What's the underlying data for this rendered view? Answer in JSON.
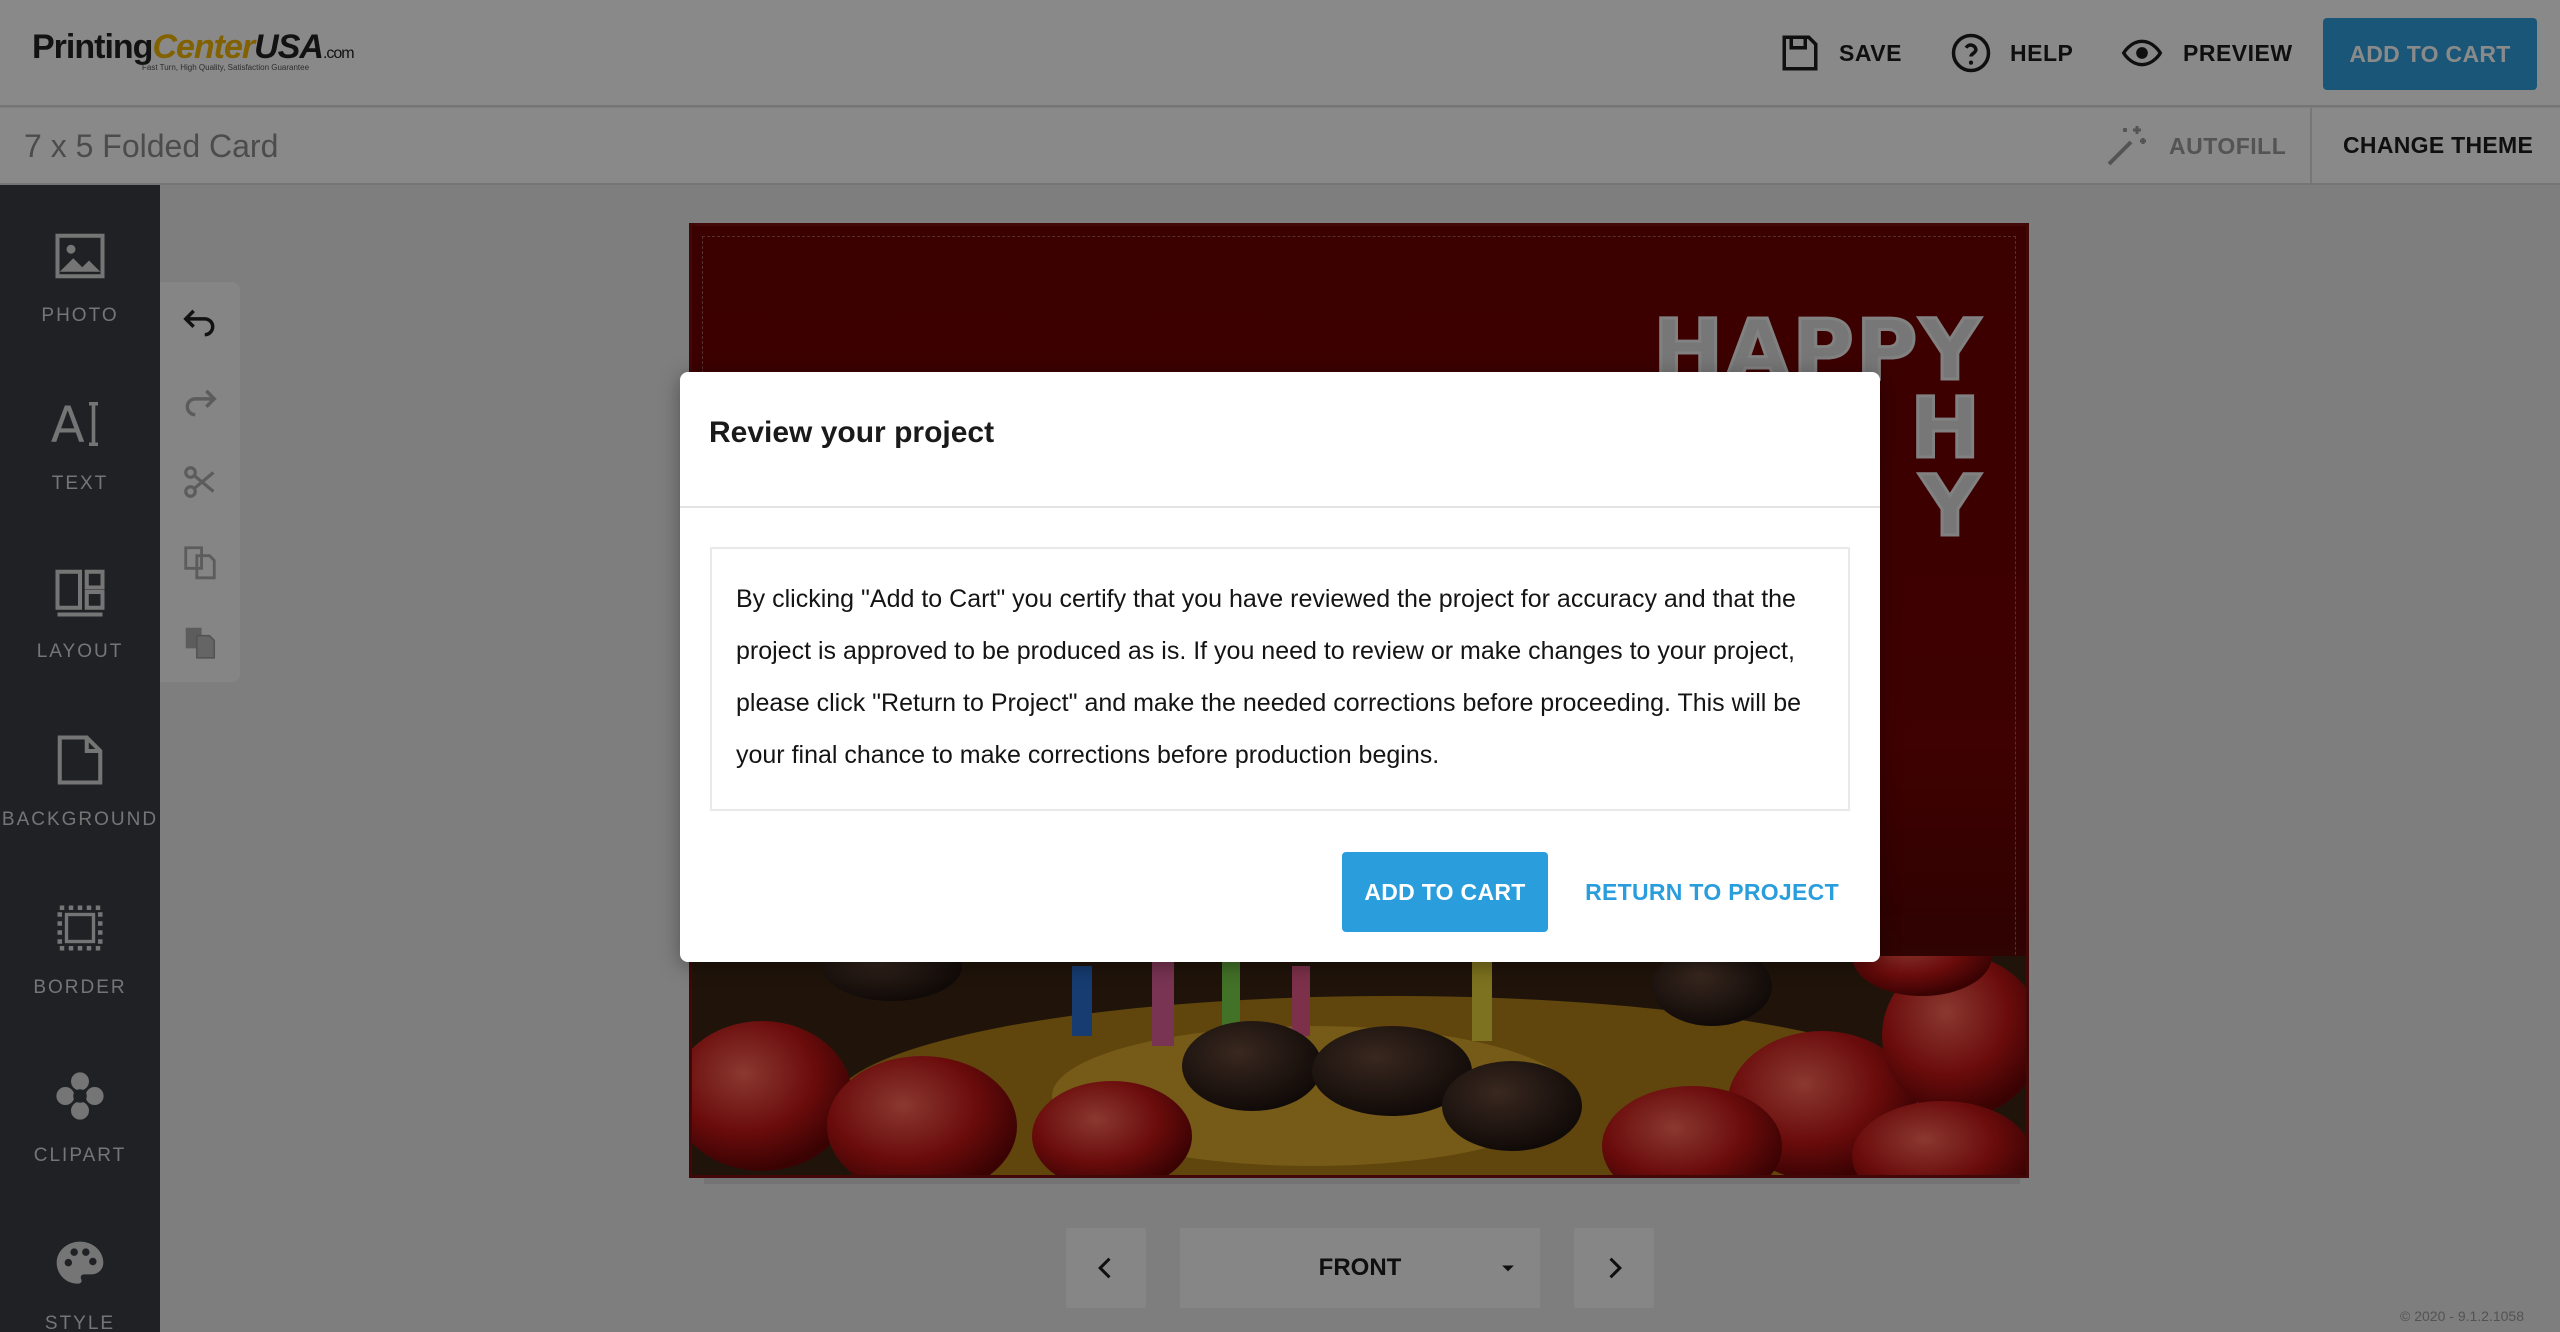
{
  "header": {
    "logo_main": "PrintingCenterUSA",
    "logo_printing": "Printing",
    "logo_center": "Center",
    "logo_usa": "USA",
    "logo_domain": ".com",
    "logo_tagline": "Fast Turn, High Quality, Satisfaction Guarantee",
    "save_label": "SAVE",
    "help_label": "HELP",
    "preview_label": "PREVIEW",
    "add_to_cart_label": "ADD TO CART"
  },
  "subbar": {
    "project_title": "7 x 5 Folded Card",
    "autofill_label": "AUTOFILL",
    "change_theme_label": "CHANGE THEME"
  },
  "sidebar": {
    "items": [
      {
        "label": "PHOTO",
        "icon": "photo-icon"
      },
      {
        "label": "TEXT",
        "icon": "text-icon"
      },
      {
        "label": "LAYOUT",
        "icon": "layout-icon"
      },
      {
        "label": "BACKGROUND",
        "icon": "background-icon"
      },
      {
        "label": "BORDER",
        "icon": "border-icon"
      },
      {
        "label": "CLIPART",
        "icon": "clipart-icon"
      },
      {
        "label": "STYLE",
        "icon": "palette-icon"
      }
    ]
  },
  "tools": [
    "undo-icon",
    "redo-icon",
    "cut-icon",
    "copy-icon",
    "paste-icon"
  ],
  "canvas": {
    "card_text_line1": "HAPPY",
    "card_text_line2": "H",
    "card_text_line3": "Y"
  },
  "page_nav": {
    "current_page": "FRONT"
  },
  "version": "© 2020 - 9.1.2.1058",
  "modal": {
    "title": "Review your project",
    "body": "By clicking \"Add to Cart\" you certify that you have reviewed the project for accuracy and that the project is approved to be produced as is. If you need to review or make changes to your project, please click \"Return to Project\" and make the needed corrections before proceeding. This will be your final chance to make corrections before production begins.",
    "add_to_cart_label": "ADD TO CART",
    "return_label": "RETURN TO PROJECT"
  },
  "colors": {
    "accent": "#2f9fdc",
    "sidebar_bg": "#3a3d44",
    "card_red": "#6d0000"
  }
}
